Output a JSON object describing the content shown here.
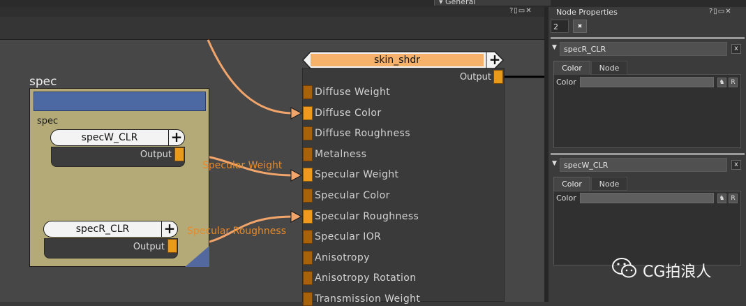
{
  "top": {
    "general_label": "▾ General"
  },
  "node_graph": {
    "window_buttons": "?▯▭✕",
    "backdrop": {
      "title": "spec",
      "inner_label": "spec"
    },
    "nodes": [
      {
        "name": "specW_CLR",
        "output_label": "Output"
      },
      {
        "name": "specR_CLR",
        "output_label": "Output"
      }
    ],
    "shader": {
      "name": "skin_shdr",
      "output_label": "Output",
      "inputs": [
        {
          "label": "Diffuse Weight",
          "connected": false
        },
        {
          "label": "Diffuse Color",
          "connected": true
        },
        {
          "label": "Diffuse Roughness",
          "connected": false
        },
        {
          "label": "Metalness",
          "connected": false
        },
        {
          "label": "Specular Weight",
          "connected": true
        },
        {
          "label": "Specular Color",
          "connected": false
        },
        {
          "label": "Specular Roughness",
          "connected": true
        },
        {
          "label": "Specular IOR",
          "connected": false
        },
        {
          "label": "Anisotropy",
          "connected": false
        },
        {
          "label": "Anisotropy Rotation",
          "connected": false
        },
        {
          "label": "Transmission Weight",
          "connected": false
        }
      ]
    },
    "wire_labels": {
      "specular_weight": "Specular Weight",
      "specular_roughness": "Specular Roughness"
    },
    "colors": {
      "wire": "#f2a56b",
      "port": "#f09a1c",
      "backdrop": "#b3aa77",
      "backdrop_bar": "#4d69a3"
    }
  },
  "properties": {
    "title": "Node Properties",
    "window_buttons": "?▯▭✕",
    "count": "2",
    "clear_icon_label": "✖",
    "sections": [
      {
        "name": "specR_CLR",
        "tabs": [
          "Color",
          "Node"
        ],
        "field_label": "Color",
        "btn_a": "♞",
        "btn_b": "R"
      },
      {
        "name": "specW_CLR",
        "tabs": [
          "Color",
          "Node"
        ],
        "field_label": "Color",
        "btn_a": "♞",
        "btn_b": "R"
      }
    ]
  },
  "watermark": {
    "text": "CG拍浪人"
  }
}
